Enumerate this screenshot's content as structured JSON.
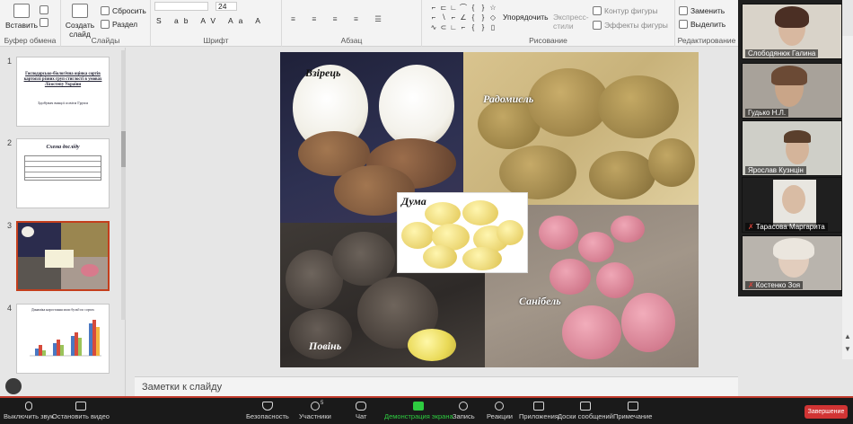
{
  "ribbon": {
    "paste_label": "Вставить",
    "create_slide_label": "Создать слайд",
    "reset_label": "Сбросить",
    "section_label": "Раздел",
    "font_size": "24",
    "arrange_label": "Упорядочить",
    "express_styles_label": "Экспресс-стили",
    "shape_outline_label": "Контур фигуры",
    "shape_effects_label": "Эффекты фигуры",
    "replace_label": "Заменить",
    "select_label": "Выделить",
    "groups": {
      "clipboard": "Буфер обмена",
      "slides": "Слайды",
      "font": "Шрифт",
      "paragraph": "Абзац",
      "drawing": "Рисование",
      "editing": "Редактирование"
    }
  },
  "thumbnails": [
    {
      "num": "1",
      "title": "Господарсько-біологічна оцінка сортів картоплі різних груп стиглості в умовах Лісостепу України",
      "subtitle": "Здобувач вищої освіти Групи"
    },
    {
      "num": "2",
      "title": "Схема досліду"
    },
    {
      "num": "3",
      "title": ""
    },
    {
      "num": "4",
      "title": "Динаміка наростання маси бульб по сортах"
    }
  ],
  "slide": {
    "labels": {
      "vzirets": "Взірець",
      "radomysl": "Радомисль",
      "duma": "Дума",
      "povin": "Повінь",
      "sanibel": "Санібель"
    }
  },
  "notes_placeholder": "Заметки к слайду",
  "participants": [
    {
      "name": "Слободянюк Галина",
      "muted": false
    },
    {
      "name": "Гудько Н.Л.",
      "muted": false
    },
    {
      "name": "Ярослав Кузнцін",
      "muted": false
    },
    {
      "name": "Тарасова Маргарита",
      "muted": true
    },
    {
      "name": "Костенко Зоя",
      "muted": true
    }
  ],
  "toolbar": {
    "mute": "Выключить звук",
    "video": "Остановить видео",
    "security": "Безопасность",
    "participants": "Участники",
    "participants_count": "5",
    "chat": "Чат",
    "share": "Демонстрация экрана",
    "record": "Запись",
    "reactions": "Реакции",
    "apps": "Приложения",
    "whiteboards": "Доски сообщений",
    "notes": "Примечание",
    "end": "Завершение"
  },
  "colors": {
    "accent": "#c43e1c",
    "share_green": "#2ecc40",
    "end_red": "#d13434"
  }
}
